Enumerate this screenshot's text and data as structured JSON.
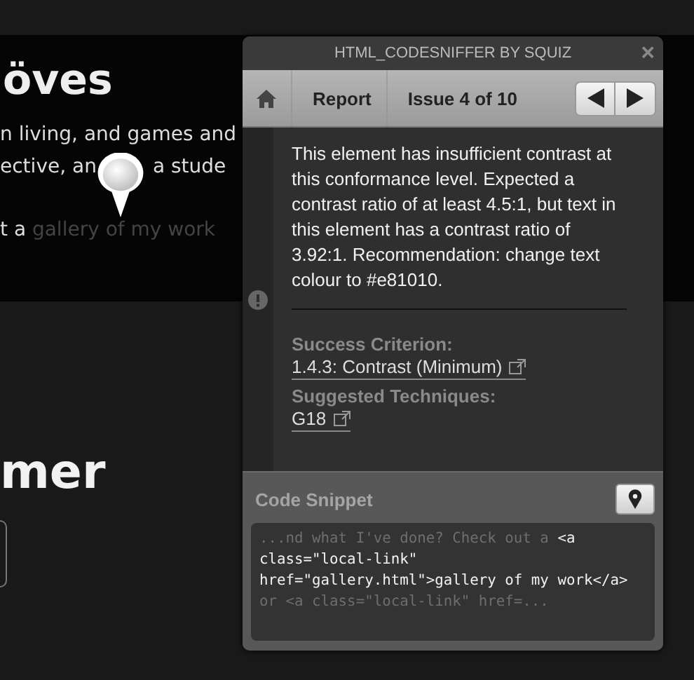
{
  "page": {
    "hero": {
      "heading": "öves",
      "line_1": "n living, and games and",
      "line_2_left": "ective, an",
      "line_2_right": "a stude",
      "line_3_prefix": "t a",
      "line_3_link": "gallery of my work"
    },
    "section_heading": "mer"
  },
  "panel": {
    "title": "HTML_CODESNIFFER BY SQUIZ",
    "close": "×",
    "breadcrumbs": [
      {
        "label": "Report"
      },
      {
        "label": "Issue 4 of 10"
      }
    ],
    "message": "This element has insufficient contrast at this conformance level. Expected a contrast ratio of at least 4.5:1, but text in this element has a contrast ratio of 3.92:1. Recommendation: change text colour to #e81010.",
    "sections": [
      {
        "label": "Success Criterion:",
        "links": [
          "1.4.3: Contrast (Minimum)"
        ]
      },
      {
        "label": "Suggested Techniques:",
        "links": [
          "G18"
        ]
      }
    ],
    "code_snippet": {
      "title": "Code Snippet",
      "parts": [
        {
          "kind": "context",
          "text": "...nd what I've done? Check out a "
        },
        {
          "kind": "element",
          "text": "<a class=\"local-link\" href=\"gallery.html\">gallery of my work</a>"
        },
        {
          "kind": "context",
          "text": " or <a class=\"local-link\" href=..."
        }
      ]
    }
  }
}
